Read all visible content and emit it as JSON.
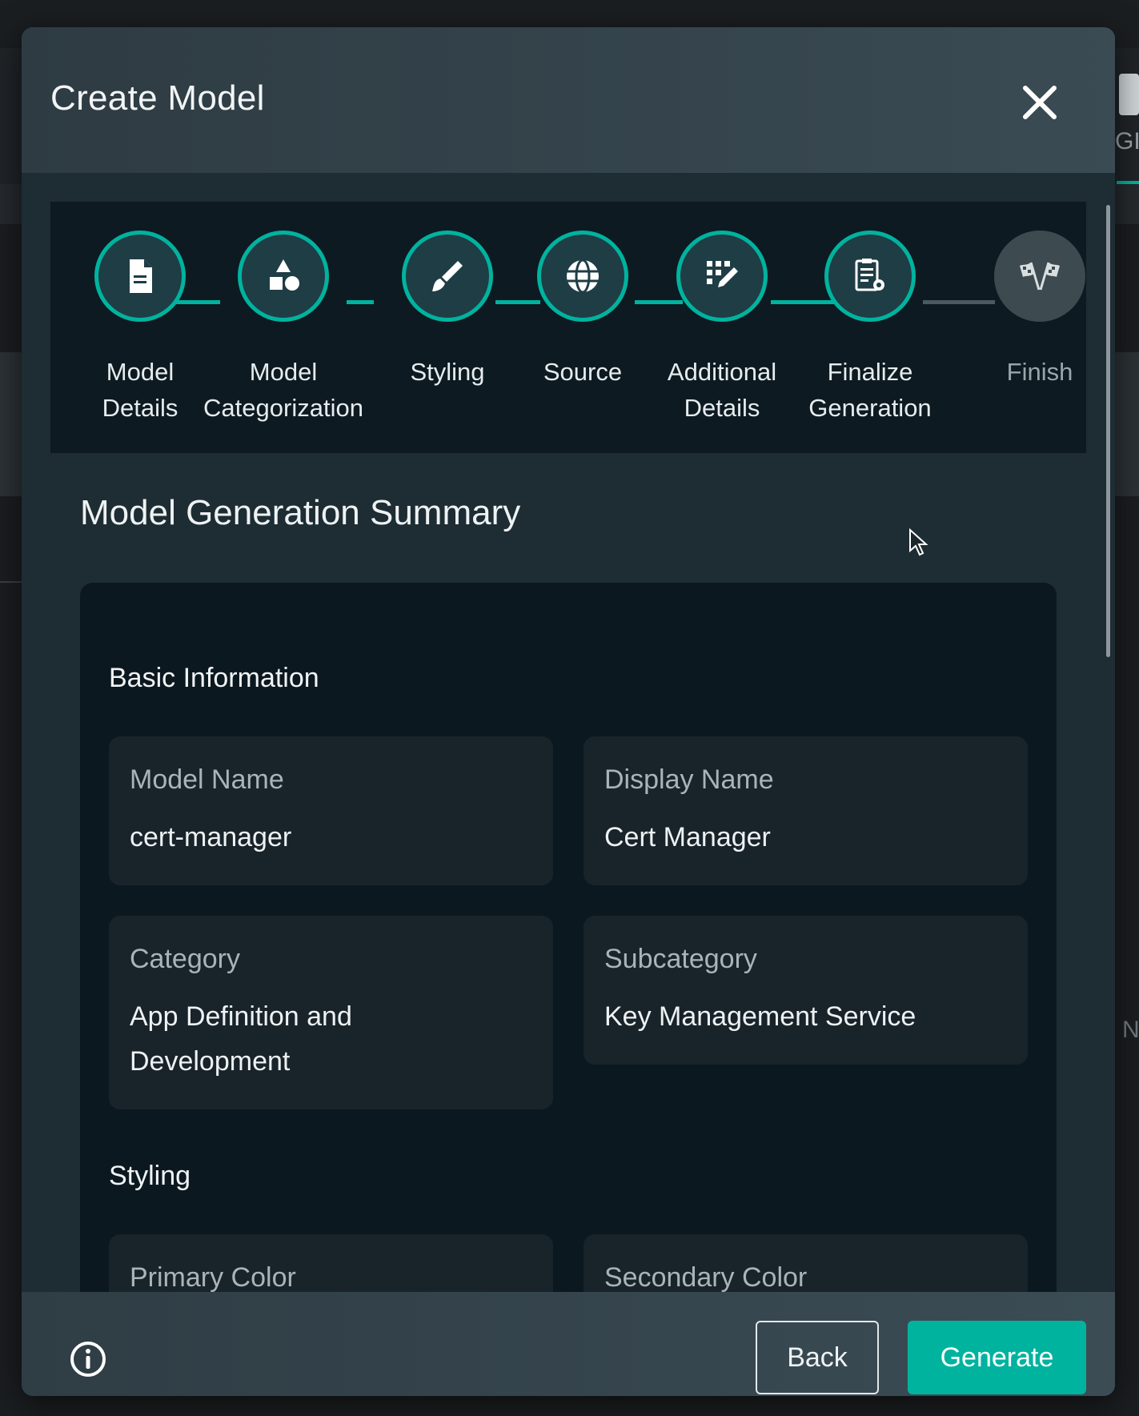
{
  "modal": {
    "title": "Create Model"
  },
  "stepper": {
    "steps": [
      {
        "label_line1": "Model",
        "label_line2": "Details",
        "icon": "document-icon",
        "active": true
      },
      {
        "label_line1": "Model",
        "label_line2": "Categorization",
        "icon": "shapes-icon",
        "active": true
      },
      {
        "label_line1": "Styling",
        "label_line2": "",
        "icon": "brush-icon",
        "active": true
      },
      {
        "label_line1": "Source",
        "label_line2": "",
        "icon": "globe-icon",
        "active": true
      },
      {
        "label_line1": "Additional",
        "label_line2": "Details",
        "icon": "grid-edit-icon",
        "active": true
      },
      {
        "label_line1": "Finalize",
        "label_line2": "Generation",
        "icon": "clipboard-gear-icon",
        "active": true
      },
      {
        "label_line1": "Finish",
        "label_line2": "",
        "icon": "checkered-flags-icon",
        "active": false
      }
    ]
  },
  "summary": {
    "title": "Model Generation Summary",
    "basic_information": {
      "heading": "Basic Information",
      "model_name_label": "Model Name",
      "model_name_value": "cert-manager",
      "display_name_label": "Display Name",
      "display_name_value": "Cert Manager",
      "category_label": "Category",
      "category_value_line1": "App Definition and",
      "category_value_line2": "Development",
      "subcategory_label": "Subcategory",
      "subcategory_value": "Key Management Service"
    },
    "styling": {
      "heading": "Styling",
      "primary_color_label": "Primary Color",
      "secondary_color_label": "Secondary Color"
    }
  },
  "footer": {
    "back_label": "Back",
    "generate_label": "Generate"
  },
  "background": {
    "right_tab_text": "GIS",
    "right_edge_text": "N"
  },
  "colors": {
    "accent": "#00b39f",
    "modal_body": "#1e2c33",
    "summary_box": "#0c1820"
  }
}
